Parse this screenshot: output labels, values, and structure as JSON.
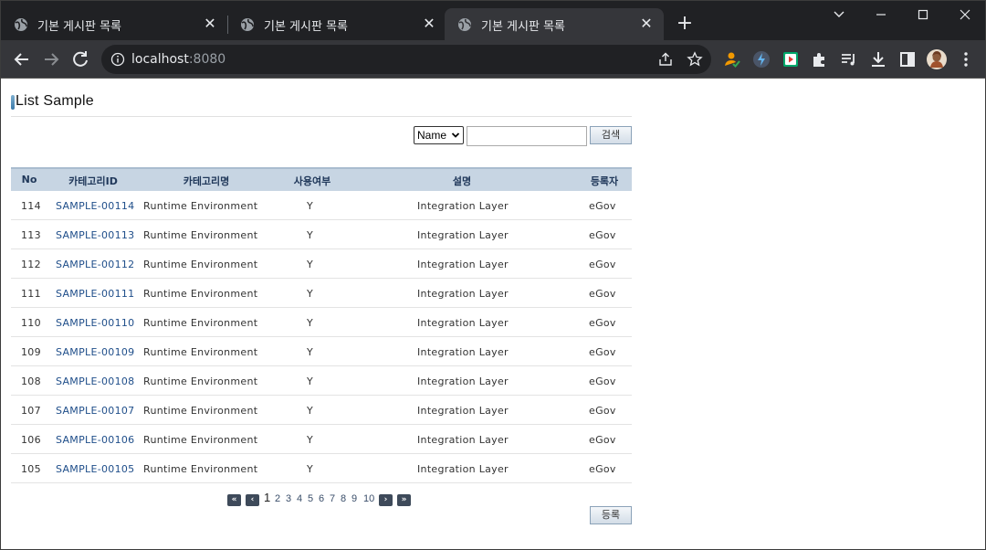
{
  "browser": {
    "tabs": [
      {
        "title": "기본 게시판 목록",
        "active": false
      },
      {
        "title": "기본 게시판 목록",
        "active": false
      },
      {
        "title": "기본 게시판 목록",
        "active": true
      }
    ],
    "url_host": "localhost",
    "url_port": ":8080"
  },
  "page": {
    "title": "List Sample",
    "search": {
      "select_value": "Name",
      "input_value": "",
      "button_label": "검색"
    },
    "table": {
      "headers": [
        "No",
        "카테고리ID",
        "카테고리명",
        "사용여부",
        "설명",
        "등록자"
      ],
      "rows": [
        {
          "no": "114",
          "id": "SAMPLE-00114",
          "name": "Runtime Environment",
          "use": "Y",
          "desc": "Integration Layer",
          "user": "eGov"
        },
        {
          "no": "113",
          "id": "SAMPLE-00113",
          "name": "Runtime Environment",
          "use": "Y",
          "desc": "Integration Layer",
          "user": "eGov"
        },
        {
          "no": "112",
          "id": "SAMPLE-00112",
          "name": "Runtime Environment",
          "use": "Y",
          "desc": "Integration Layer",
          "user": "eGov"
        },
        {
          "no": "111",
          "id": "SAMPLE-00111",
          "name": "Runtime Environment",
          "use": "Y",
          "desc": "Integration Layer",
          "user": "eGov"
        },
        {
          "no": "110",
          "id": "SAMPLE-00110",
          "name": "Runtime Environment",
          "use": "Y",
          "desc": "Integration Layer",
          "user": "eGov"
        },
        {
          "no": "109",
          "id": "SAMPLE-00109",
          "name": "Runtime Environment",
          "use": "Y",
          "desc": "Integration Layer",
          "user": "eGov"
        },
        {
          "no": "108",
          "id": "SAMPLE-00108",
          "name": "Runtime Environment",
          "use": "Y",
          "desc": "Integration Layer",
          "user": "eGov"
        },
        {
          "no": "107",
          "id": "SAMPLE-00107",
          "name": "Runtime Environment",
          "use": "Y",
          "desc": "Integration Layer",
          "user": "eGov"
        },
        {
          "no": "106",
          "id": "SAMPLE-00106",
          "name": "Runtime Environment",
          "use": "Y",
          "desc": "Integration Layer",
          "user": "eGov"
        },
        {
          "no": "105",
          "id": "SAMPLE-00105",
          "name": "Runtime Environment",
          "use": "Y",
          "desc": "Integration Layer",
          "user": "eGov"
        }
      ]
    },
    "pager": {
      "first": "«",
      "prev": "‹",
      "next": "›",
      "last": "»",
      "pages": [
        "1",
        "2",
        "3",
        "4",
        "5",
        "6",
        "7",
        "8",
        "9",
        "10"
      ],
      "current": "1"
    },
    "register_button_label": "등록"
  },
  "icons": {
    "favicon": "globe-icon",
    "back": "arrow-left-icon",
    "forward": "arrow-right-icon",
    "reload": "reload-icon",
    "info": "info-icon",
    "share": "share-icon",
    "bookmark": "star-icon",
    "extensions": "puzzle-icon",
    "download": "download-icon",
    "sidepanel": "side-panel-icon",
    "menu": "kebab-menu-icon"
  },
  "colors": {
    "tab_strip": "#202124",
    "toolbar": "#35363a",
    "table_header": "#c7d5e3",
    "link": "#1f4e8a"
  }
}
